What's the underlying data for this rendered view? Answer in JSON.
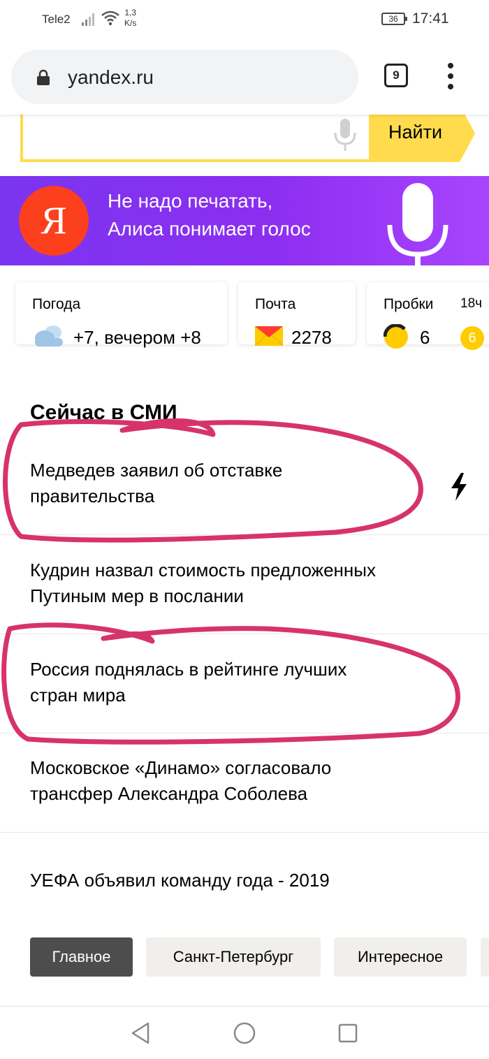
{
  "status_bar": {
    "carrier": "Tele2",
    "speed_value": "1,3",
    "speed_unit": "K/s",
    "battery": "36",
    "time": "17:41"
  },
  "browser": {
    "url": "yandex.ru",
    "tab_count": "9"
  },
  "search": {
    "button_label": "Найти",
    "accent_color": "#ffdb4d"
  },
  "alice_banner": {
    "logo_letter": "Я",
    "line1": "Не надо печатать,",
    "line2": "Алиса понимает голос"
  },
  "widgets": {
    "weather": {
      "title": "Погода",
      "value": "+7, вечером +8",
      "icon": "cloud-icon"
    },
    "mail": {
      "title": "Почта",
      "value": "2278",
      "icon": "envelope-icon"
    },
    "traffic": {
      "title": "Пробки",
      "value": "6",
      "time": "18ч",
      "forecast": "6",
      "icon": "traffic-light-icon"
    }
  },
  "news": {
    "heading": "Сейчас в СМИ",
    "items": [
      {
        "line1": "Медведев заявил об отставке",
        "line2": "правительства"
      },
      {
        "line1": "Кудрин назвал стоимость предложенных",
        "line2": "Путиным мер в послании"
      },
      {
        "line1": "Россия поднялась в рейтинге лучших",
        "line2": "стран мира"
      },
      {
        "line1": "Московское «Динамо» согласовало",
        "line2": "трансфер Александра Соболева"
      },
      {
        "line1": "УЕФА объявил команду года - 2019",
        "line2": ""
      }
    ],
    "annotation_color": "#d6336c"
  },
  "region_tabs": [
    "Главное",
    "Санкт-Петербург",
    "Интересное"
  ]
}
